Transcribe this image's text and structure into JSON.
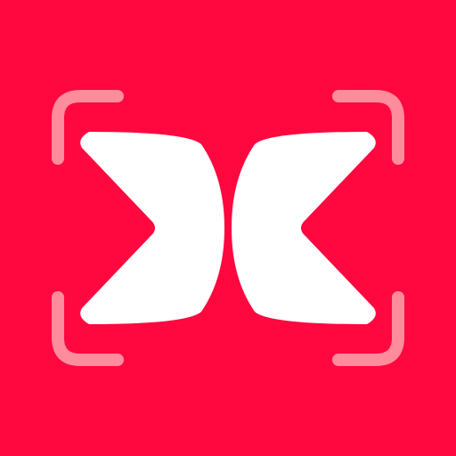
{
  "icon": {
    "semantic": "scanner-app-icon",
    "colors": {
      "background": "#FF0840",
      "mark": "#FFFFFF",
      "viewfinder": "#FF8C9C"
    }
  }
}
